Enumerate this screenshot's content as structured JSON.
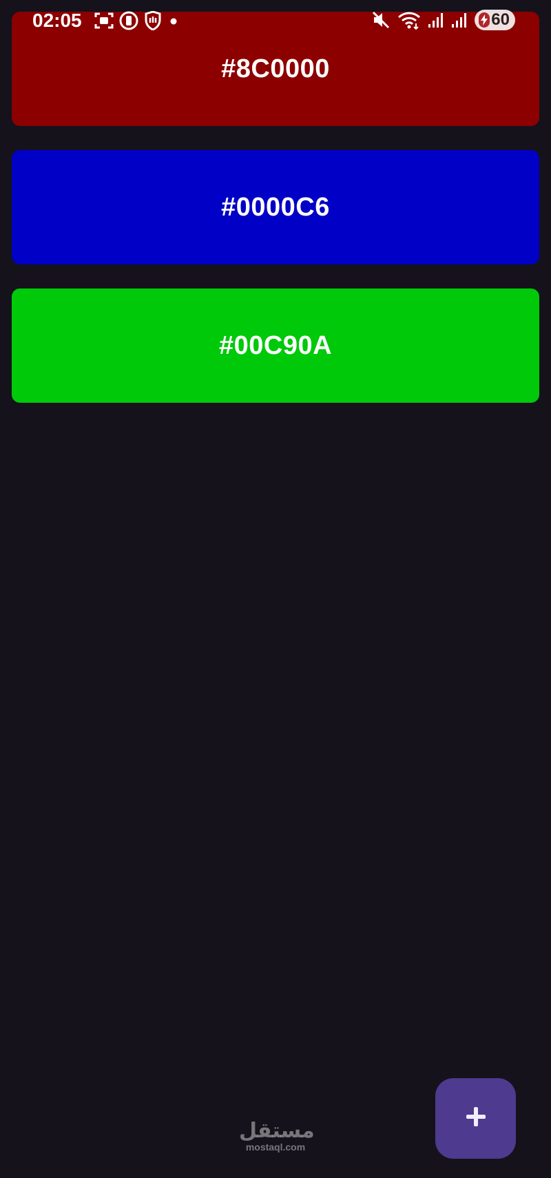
{
  "status_bar": {
    "time": "02:05",
    "battery_level": "60",
    "left_icons": [
      "screen-record-icon",
      "notification-app-icon",
      "hand-shield-icon",
      "dot-icon"
    ],
    "right_icons": [
      "mute-icon",
      "wifi-icon",
      "signal-1-icon",
      "signal-2-icon",
      "battery-icon"
    ]
  },
  "colors": [
    {
      "label": "#8C0000",
      "hex": "#8C0000"
    },
    {
      "label": "#0000C6",
      "hex": "#0000C6"
    },
    {
      "label": "#00C90A",
      "hex": "#00C90A"
    }
  ],
  "fab": {
    "icon": "plus-icon",
    "color": "#4E3A8E"
  },
  "watermark": {
    "arabic": "مستقل",
    "latin": "mostaql.com"
  },
  "theme": {
    "background": "#15121C"
  }
}
